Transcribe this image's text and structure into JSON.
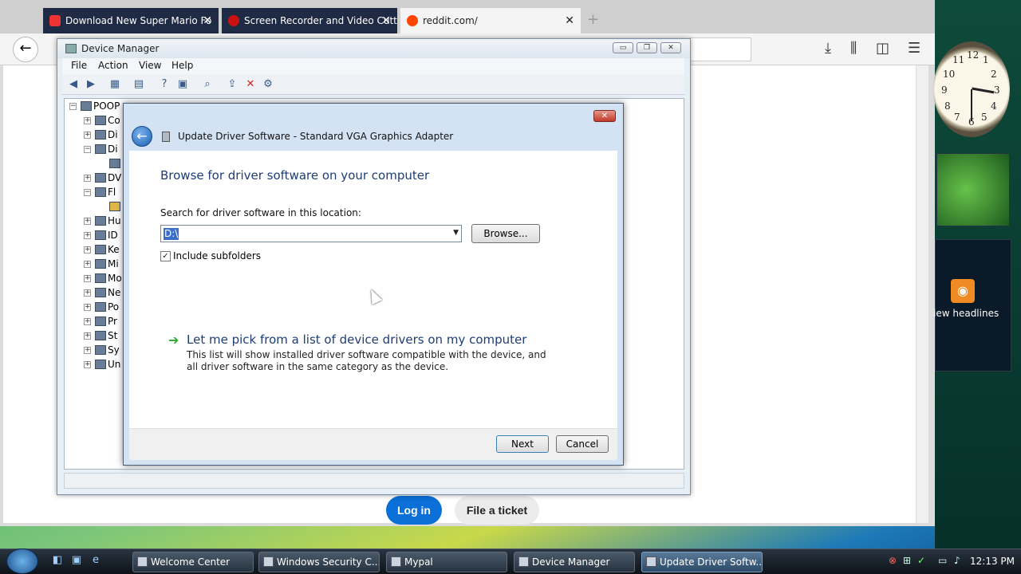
{
  "browser": {
    "tabs": [
      {
        "label": "Download New Super Mario Fo",
        "active": false
      },
      {
        "label": "Screen Recorder and Video Cutt",
        "active": false
      },
      {
        "label": "reddit.com/",
        "active": true
      }
    ],
    "new_tab": "+",
    "close_glyph": "✕",
    "back_glyph": "←",
    "nav_icons": [
      "download-icon",
      "library-icon",
      "sidebar-icon",
      "menu-icon"
    ],
    "login_label": "Log in",
    "ticket_label": "File a ticket"
  },
  "device_manager": {
    "title": "Device Manager",
    "window_buttons": [
      "▭",
      "❐",
      "✕"
    ],
    "menu": [
      "File",
      "Action",
      "View",
      "Help"
    ],
    "toolbar_icons": [
      "back-icon",
      "forward-icon",
      "properties-icon",
      "view-icon",
      "help-icon",
      "console-icon",
      "scan-icon",
      "update-icon",
      "uninstall-icon",
      "disable-icon"
    ],
    "tree": [
      {
        "label": "POOP",
        "expander": "−"
      },
      {
        "label": "Co",
        "expander": "+"
      },
      {
        "label": "Di",
        "expander": "+"
      },
      {
        "label": "Di",
        "expander": "−"
      },
      {
        "label": "",
        "expander": ""
      },
      {
        "label": "DV",
        "expander": "+"
      },
      {
        "label": "Fl",
        "expander": "−"
      },
      {
        "label": "",
        "expander": ""
      },
      {
        "label": "Hu",
        "expander": "+"
      },
      {
        "label": "ID",
        "expander": "+"
      },
      {
        "label": "Ke",
        "expander": "+"
      },
      {
        "label": "Mi",
        "expander": "+"
      },
      {
        "label": "Mo",
        "expander": "+"
      },
      {
        "label": "Ne",
        "expander": "+"
      },
      {
        "label": "Po",
        "expander": "+"
      },
      {
        "label": "Pr",
        "expander": "+"
      },
      {
        "label": "St",
        "expander": "+"
      },
      {
        "label": "Sy",
        "expander": "+"
      },
      {
        "label": "Un",
        "expander": "+"
      }
    ]
  },
  "dialog": {
    "title": "Update Driver Software - Standard VGA Graphics Adapter",
    "close_glyph": "✕",
    "back_glyph": "←",
    "heading": "Browse for driver software on your computer",
    "search_label": "Search for driver software in this location:",
    "path_value": "D:\\",
    "combo_arrow": "▼",
    "browse_label": "Browse...",
    "include_subfolders": {
      "label": "Include subfolders",
      "checked": true,
      "glyph": "✓"
    },
    "pick_arrow": "➔",
    "pick_link": "Let me pick from a list of device drivers on my computer",
    "pick_desc": "This list will show installed driver software compatible with the device, and all driver software in the same category as the device.",
    "next_label": "Next",
    "cancel_label": "Cancel"
  },
  "sidebar": {
    "clock_numbers": [
      "12",
      "1",
      "2",
      "3",
      "4",
      "5",
      "6",
      "7",
      "8",
      "9",
      "10",
      "11"
    ],
    "rss_glyph": "◉",
    "feeds_label": "iew headlines"
  },
  "taskbar": {
    "buttons": [
      {
        "label": "Welcome Center",
        "active": false
      },
      {
        "label": "Windows Security C...",
        "active": false
      },
      {
        "label": "Mypal",
        "active": false
      },
      {
        "label": "Device Manager",
        "active": false
      },
      {
        "label": "Update Driver Softw...",
        "active": true
      }
    ],
    "quick_launch": [
      "◧",
      "▣",
      "e"
    ],
    "tray_icons": [
      "⊗",
      "⊞",
      "✓",
      "▭",
      "♪"
    ],
    "time": "12:13 PM"
  }
}
